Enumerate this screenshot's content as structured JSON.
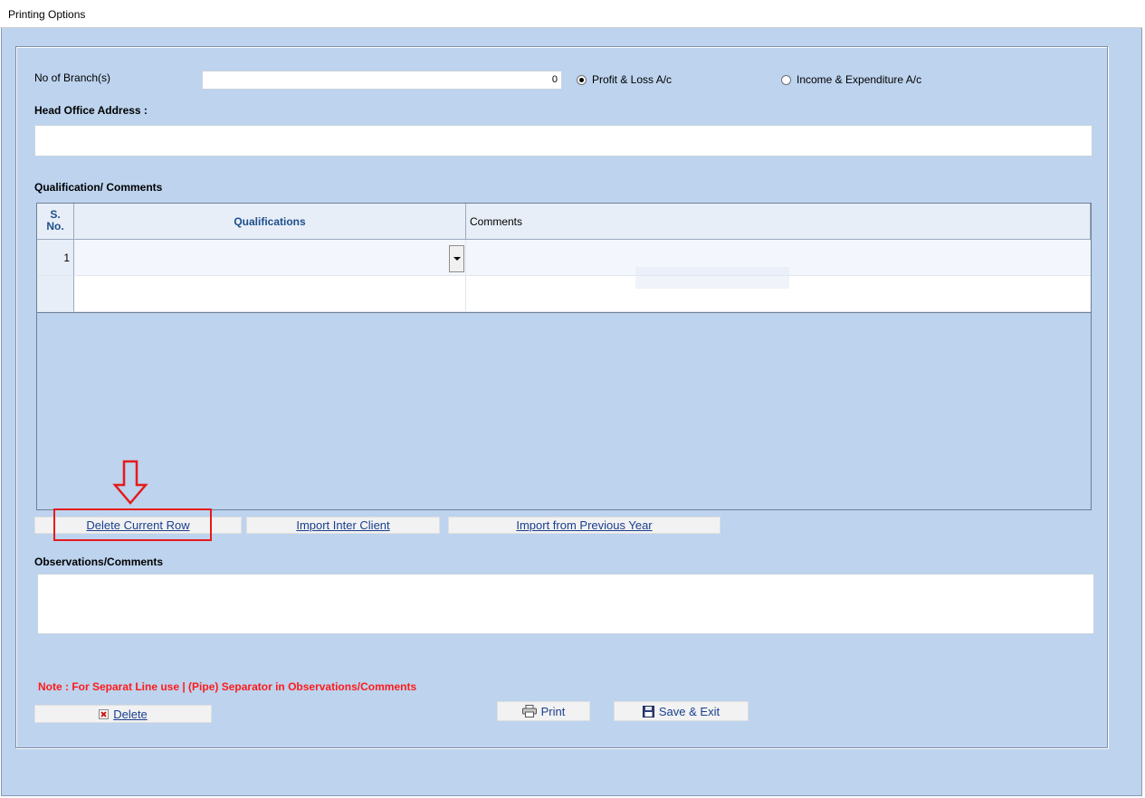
{
  "window": {
    "title": "Printing Options"
  },
  "form": {
    "branch_label": "No of Branch(s)",
    "branch_value": "0",
    "radio_profit_loss": "Profit & Loss A/c",
    "radio_income_exp": "Income & Expenditure A/c",
    "selected_radio": "Profit & Loss A/c",
    "head_office_label": "Head Office Address :",
    "head_office_value": "",
    "qualification_label": "Qualification/ Comments",
    "observations_label": "Observations/Comments",
    "observations_value": ""
  },
  "grid": {
    "headers": {
      "sno": "S.\nNo.",
      "qualifications": "Qualifications",
      "comments": "Comments"
    },
    "rows": [
      {
        "sno": "1",
        "qualification": "",
        "comments": ""
      },
      {
        "sno": "",
        "qualification": "",
        "comments": ""
      }
    ]
  },
  "buttons": {
    "delete_row": "Delete Current Row",
    "import_inter_client": "Import Inter Client",
    "import_prev_year": "Import from Previous Year",
    "delete": "Delete",
    "print": "Print",
    "save_exit": "Save & Exit"
  },
  "note": "Note : For Separat Line use | (Pipe) Separator in Observations/Comments",
  "colors": {
    "background": "#bdd3ee",
    "button_text": "#1a3f8f",
    "note_text": "#ff1a1a",
    "highlight": "#e51b1b",
    "header_text": "#1f4f8c"
  },
  "icons": {
    "arrow": "down-arrow-icon",
    "delete": "delete-x-icon",
    "print": "printer-icon",
    "save": "floppy-disk-icon"
  }
}
